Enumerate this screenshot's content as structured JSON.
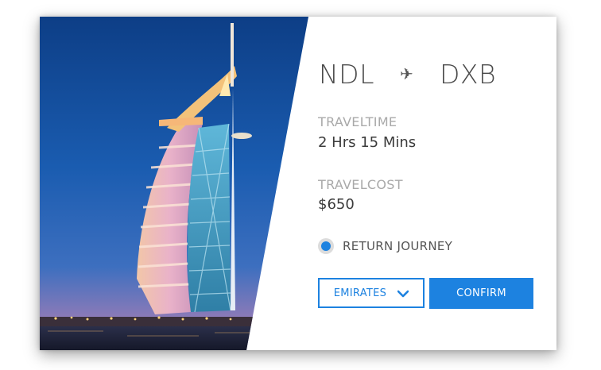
{
  "route": {
    "from": "NDL",
    "to": "DXB",
    "icon": "airplane-icon"
  },
  "travel_time": {
    "label": "TRAVELTIME",
    "value": "2 Hrs 15 Mins"
  },
  "travel_cost": {
    "label": "TRAVELCOST",
    "value": "$650"
  },
  "return_journey": {
    "label": "RETURN JOURNEY",
    "selected": true
  },
  "airline_select": {
    "value": "EMIRATES",
    "icon": "chevron-down-icon"
  },
  "confirm": {
    "label": "CONFIRM"
  },
  "colors": {
    "accent": "#1d82e0",
    "label": "#a9a9a9",
    "text": "#3b3b3b"
  }
}
